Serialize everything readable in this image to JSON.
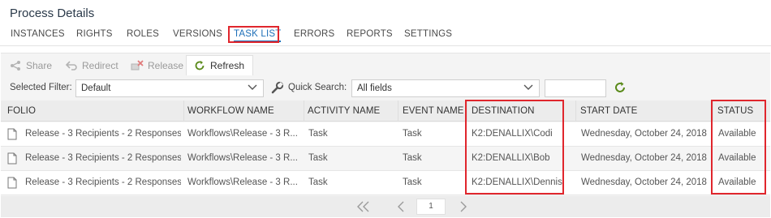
{
  "page": {
    "title": "Process Details"
  },
  "tabs": [
    {
      "label": "INSTANCES"
    },
    {
      "label": "RIGHTS"
    },
    {
      "label": "ROLES"
    },
    {
      "label": "VERSIONS"
    },
    {
      "label": "TASK LIST"
    },
    {
      "label": "ERRORS"
    },
    {
      "label": "REPORTS"
    },
    {
      "label": "SETTINGS"
    }
  ],
  "active_tab": "TASK LIST",
  "toolbar": {
    "share_label": "Share",
    "redirect_label": "Redirect",
    "release_label": "Release",
    "refresh_label": "Refresh"
  },
  "filters": {
    "selected_filter_label": "Selected Filter:",
    "selected_filter_value": "Default",
    "quick_search_label": "Quick Search:",
    "quick_search_field": "All fields",
    "quick_search_text": ""
  },
  "grid": {
    "columns": [
      "FOLIO",
      "WORKFLOW NAME",
      "ACTIVITY NAME",
      "EVENT NAME",
      "DESTINATION",
      "START DATE",
      "STATUS"
    ],
    "rows": [
      [
        "Release - 3 Recipients - 2 Responses",
        "Workflows\\Release - 3 R...",
        "Task",
        "Task",
        "K2:DENALLIX\\Codi",
        "Wednesday, October 24, 2018",
        "Available"
      ],
      [
        "Release - 3 Recipients - 2 Responses",
        "Workflows\\Release - 3 R...",
        "Task",
        "Task",
        "K2:DENALLIX\\Bob",
        "Wednesday, October 24, 2018",
        "Available"
      ],
      [
        "Release - 3 Recipients - 2 Responses",
        "Workflows\\Release - 3 R...",
        "Task",
        "Task",
        "K2:DENALLIX\\Dennis",
        "Wednesday, October 24, 2018",
        "Available"
      ]
    ]
  },
  "pager": {
    "current_page": "1"
  },
  "colors": {
    "accent": "#1e6fb8",
    "highlight": "#e0262d",
    "refresh_icon": "#5a8a1a"
  }
}
